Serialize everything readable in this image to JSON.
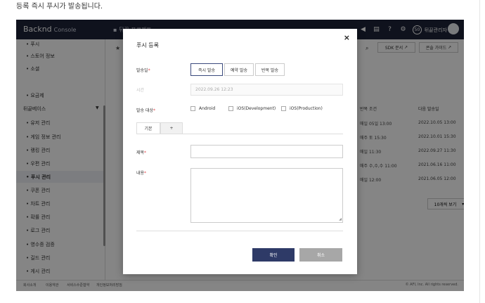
{
  "doc_caption": "등록 즉시 푸시가 발송됩니다.",
  "app": {
    "logo_main": "Backnd",
    "logo_sub": "Console",
    "breadcrumb": "뒤끝 프로젝트",
    "notification_count": "50",
    "username": "뒤끝관리자"
  },
  "sidebar": {
    "items_top": [
      {
        "label": "푸시"
      },
      {
        "label": "스토어 정보"
      },
      {
        "label": "소셜"
      }
    ],
    "item_billing": "요금제",
    "group_label": "뒤끝베이스",
    "group_items": [
      {
        "label": "유저 관리"
      },
      {
        "label": "게임 정보 관리"
      },
      {
        "label": "랭킹 관리"
      },
      {
        "label": "우편 관리"
      },
      {
        "label": "푸시 관리"
      },
      {
        "label": "쿠폰 관리"
      },
      {
        "label": "차트 관리"
      },
      {
        "label": "확률 관리"
      },
      {
        "label": "로그 관리"
      },
      {
        "label": "영수증 검증"
      },
      {
        "label": "길드 관리"
      },
      {
        "label": "게시 관리"
      }
    ]
  },
  "toolbar": {
    "sdk_docs": "SDK 문서",
    "console_guide": "콘솔 가이드"
  },
  "table": {
    "headers": {
      "repeat": "반복 조건",
      "next": "다음 발송일"
    },
    "rows": [
      {
        "repeat": "매일 05일 13:00",
        "next": "2022.10.05 13:00"
      },
      {
        "repeat": "매주 토 15:30",
        "next": "2022.10.01 15:30"
      },
      {
        "repeat": "매일 11:30",
        "next": "2022.09.27 11:30"
      },
      {
        "repeat": "매주 수,수,수 11:00",
        "next": "2021.06.16 11:00"
      },
      {
        "repeat": "매일 12:00",
        "next": "2021.06.05 12:00"
      }
    ],
    "page_size": "10개씩 보기"
  },
  "footer": {
    "links": [
      "회사소개",
      "이용약관",
      "서비스수준협약",
      "개인정보처리방침"
    ],
    "copyright": "© AFI, Inc. All rights reserved."
  },
  "modal": {
    "title": "푸시 등록",
    "send_type_label": "발송일",
    "send_types": [
      "즉시 발송",
      "예약 발송",
      "반복 발송"
    ],
    "time_label": "시간",
    "time_value": "2022.09.26 12:23",
    "target_label": "발송 대상",
    "targets": [
      "Android",
      "iOS(Development)",
      "iOS(Production)"
    ],
    "tab_default": "기본",
    "tab_add": "+",
    "title_field_label": "제목",
    "content_field_label": "내용",
    "confirm": "확인",
    "cancel": "취소"
  },
  "colors": {
    "topbar": "#1d2338",
    "primary_button": "#2e3a67",
    "cancel_button": "#a7a7a7",
    "required_mark": "#e0474c"
  }
}
